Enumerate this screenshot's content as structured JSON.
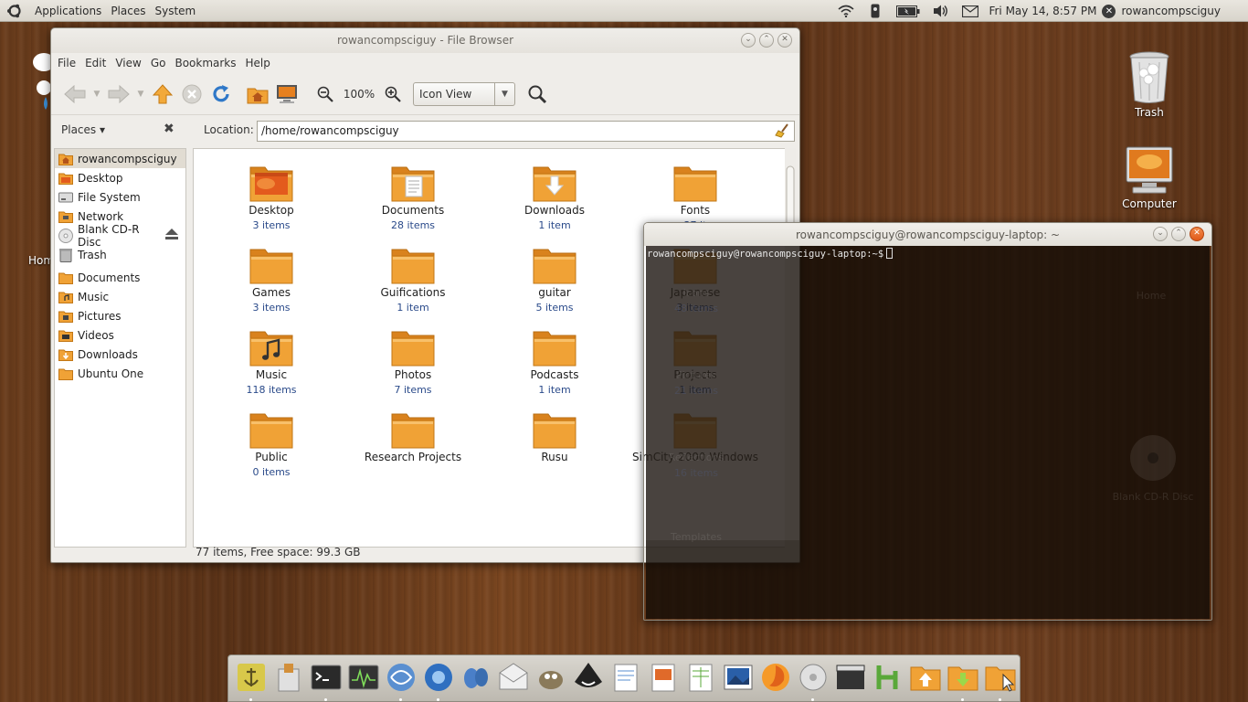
{
  "top_panel": {
    "menus": [
      "Applications",
      "Places",
      "System"
    ],
    "clock": "Fri May 14,  8:57 PM",
    "user": "rowancompsciguy"
  },
  "desktop": {
    "icons": [
      {
        "label": "Trash"
      },
      {
        "label": "Computer"
      },
      {
        "label": "Hom"
      }
    ]
  },
  "file_browser": {
    "title": "rowancompsciguy - File Browser",
    "menus": [
      "File",
      "Edit",
      "View",
      "Go",
      "Bookmarks",
      "Help"
    ],
    "zoom": "100%",
    "view_mode": "Icon View",
    "places_label": "Places",
    "location_label": "Location:",
    "location_value": "/home/rowancompsciguy",
    "sidebar": [
      {
        "label": "rowancompsciguy",
        "icon": "home-folder-icon"
      },
      {
        "label": "Desktop",
        "icon": "desktop-icon"
      },
      {
        "label": "File System",
        "icon": "harddisk-icon"
      },
      {
        "label": "Network",
        "icon": "network-icon"
      },
      {
        "label": "Blank CD-R Disc",
        "icon": "cd-icon"
      },
      {
        "label": "Trash",
        "icon": "trash-icon"
      },
      {
        "label": "Documents",
        "icon": "folder-icon"
      },
      {
        "label": "Music",
        "icon": "music-folder-icon"
      },
      {
        "label": "Pictures",
        "icon": "pictures-folder-icon"
      },
      {
        "label": "Videos",
        "icon": "videos-folder-icon"
      },
      {
        "label": "Downloads",
        "icon": "downloads-folder-icon"
      },
      {
        "label": "Ubuntu One",
        "icon": "folder-icon"
      }
    ],
    "items": [
      {
        "name": "Desktop",
        "count": "3 items"
      },
      {
        "name": "Documents",
        "count": "28 items"
      },
      {
        "name": "Downloads",
        "count": "1 item"
      },
      {
        "name": "Fonts",
        "count": "27 it"
      },
      {
        "name": "Games",
        "count": "3 items"
      },
      {
        "name": "Guifications",
        "count": "1 item"
      },
      {
        "name": "guitar",
        "count": "5 items"
      },
      {
        "name": "Japanese",
        "count": "3 items"
      },
      {
        "name": "Music",
        "count": "118 items"
      },
      {
        "name": "Photos",
        "count": "7 items"
      },
      {
        "name": "Podcasts",
        "count": "1 item"
      },
      {
        "name": "Projects",
        "count": "1 item"
      },
      {
        "name": "Public",
        "count": "0 items"
      },
      {
        "name": "Research Projects",
        "count": ""
      },
      {
        "name": "Rusu",
        "count": ""
      },
      {
        "name": "SimCity 2000 Windows",
        "count": ""
      }
    ],
    "status": "77 items, Free space: 99.3 GB"
  },
  "terminal": {
    "title": "rowancompsciguy@rowancompsciguy-laptop: ~",
    "prompt": "rowancompsciguy@rowancompsciguy-laptop:~$",
    "ghost_labels": [
      "Icons",
      "48 items",
      "Pictures",
      "21 items",
      "Reflections",
      "16 items",
      "Templates",
      "Home",
      "Blank CD-R Disc"
    ]
  },
  "dock": {
    "items": [
      "anchor-icon",
      "package-icon",
      "terminal-icon",
      "system-monitor-icon",
      "network-manager-icon",
      "chromium-icon",
      "pidgin-icon",
      "mail-icon",
      "gimp-icon",
      "inkscape-icon",
      "writer-icon",
      "impress-icon",
      "calc-icon",
      "image-viewer-icon",
      "firefox-icon",
      "disk-utility-icon",
      "video-editor-icon",
      "h-app-icon",
      "folder-up-icon",
      "downloads-folder-icon",
      "folder-cursor-icon"
    ]
  },
  "colors": {
    "folder": "#f0a236",
    "folder_dark": "#d9821d",
    "count_text": "#2a4a8a",
    "terminal_bg": "#140c06"
  }
}
